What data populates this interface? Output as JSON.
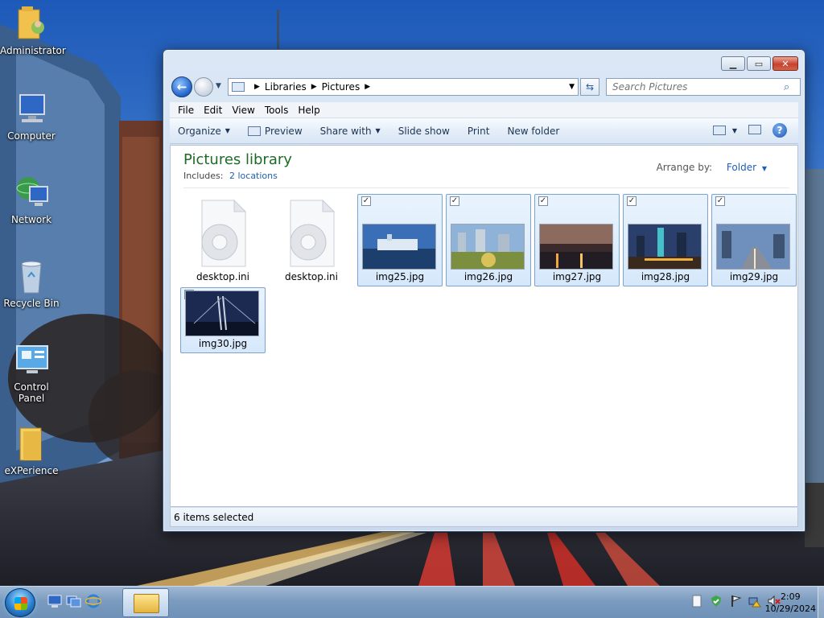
{
  "desktop": {
    "icons": [
      {
        "label": "Administrator",
        "icon": "user-folder-icon"
      },
      {
        "label": "Computer",
        "icon": "computer-icon"
      },
      {
        "label": "Network",
        "icon": "network-globe-icon"
      },
      {
        "label": "Recycle Bin",
        "icon": "recycle-bin-icon"
      },
      {
        "label": "Control Panel",
        "icon": "control-panel-icon"
      },
      {
        "label": "eXPerience",
        "icon": "folder-icon"
      }
    ]
  },
  "window": {
    "address": {
      "segments": [
        "Libraries",
        "Pictures"
      ]
    },
    "search": {
      "placeholder": "Search Pictures"
    },
    "menu": [
      "File",
      "Edit",
      "View",
      "Tools",
      "Help"
    ],
    "toolbar": {
      "organize": "Organize",
      "preview": "Preview",
      "share_with": "Share with",
      "slide_show": "Slide show",
      "print": "Print",
      "new_folder": "New folder"
    },
    "library": {
      "title": "Pictures library",
      "includes_label": "Includes:",
      "locations_link": "2 locations",
      "arrange_label": "Arrange by:",
      "arrange_value": "Folder"
    },
    "files": [
      {
        "name": "desktop.ini",
        "type": "ini",
        "selected": false
      },
      {
        "name": "desktop.ini",
        "type": "ini",
        "selected": false
      },
      {
        "name": "img25.jpg",
        "type": "jpg",
        "selected": true
      },
      {
        "name": "img26.jpg",
        "type": "jpg",
        "selected": true
      },
      {
        "name": "img27.jpg",
        "type": "jpg",
        "selected": true
      },
      {
        "name": "img28.jpg",
        "type": "jpg",
        "selected": true
      },
      {
        "name": "img29.jpg",
        "type": "jpg",
        "selected": true
      },
      {
        "name": "img30.jpg",
        "type": "jpg",
        "selected": true
      }
    ],
    "status": "6 items selected"
  },
  "taskbar": {
    "clock": {
      "time": "2:09",
      "date": "10/29/2024"
    }
  },
  "colors": {
    "library_title": "#1e6b25",
    "link": "#1f5fb5",
    "selection_fill": "#d6e8fb",
    "selection_border": "#7da2ce",
    "close_button": "#c7412c"
  }
}
